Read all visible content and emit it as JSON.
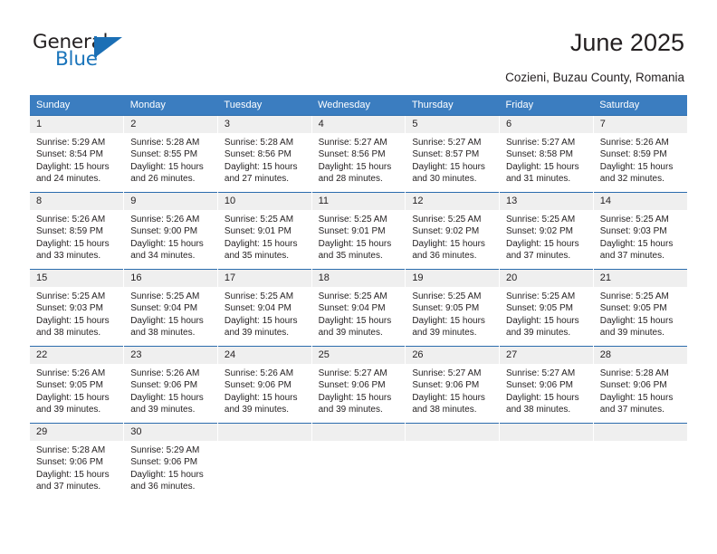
{
  "brand": {
    "name_part1": "General",
    "name_part2": "Blue",
    "accent_color": "#1b6fb5"
  },
  "header": {
    "title": "June 2025",
    "subtitle": "Cozieni, Buzau County, Romania"
  },
  "calendar": {
    "header_bg": "#3b7dc0",
    "daynum_bg": "#efefef",
    "row_divider_color": "#2b6cad",
    "weekday_headers": [
      "Sunday",
      "Monday",
      "Tuesday",
      "Wednesday",
      "Thursday",
      "Friday",
      "Saturday"
    ],
    "weeks": [
      [
        {
          "day": "1",
          "sunrise": "Sunrise: 5:29 AM",
          "sunset": "Sunset: 8:54 PM",
          "daylight1": "Daylight: 15 hours",
          "daylight2": "and 24 minutes."
        },
        {
          "day": "2",
          "sunrise": "Sunrise: 5:28 AM",
          "sunset": "Sunset: 8:55 PM",
          "daylight1": "Daylight: 15 hours",
          "daylight2": "and 26 minutes."
        },
        {
          "day": "3",
          "sunrise": "Sunrise: 5:28 AM",
          "sunset": "Sunset: 8:56 PM",
          "daylight1": "Daylight: 15 hours",
          "daylight2": "and 27 minutes."
        },
        {
          "day": "4",
          "sunrise": "Sunrise: 5:27 AM",
          "sunset": "Sunset: 8:56 PM",
          "daylight1": "Daylight: 15 hours",
          "daylight2": "and 28 minutes."
        },
        {
          "day": "5",
          "sunrise": "Sunrise: 5:27 AM",
          "sunset": "Sunset: 8:57 PM",
          "daylight1": "Daylight: 15 hours",
          "daylight2": "and 30 minutes."
        },
        {
          "day": "6",
          "sunrise": "Sunrise: 5:27 AM",
          "sunset": "Sunset: 8:58 PM",
          "daylight1": "Daylight: 15 hours",
          "daylight2": "and 31 minutes."
        },
        {
          "day": "7",
          "sunrise": "Sunrise: 5:26 AM",
          "sunset": "Sunset: 8:59 PM",
          "daylight1": "Daylight: 15 hours",
          "daylight2": "and 32 minutes."
        }
      ],
      [
        {
          "day": "8",
          "sunrise": "Sunrise: 5:26 AM",
          "sunset": "Sunset: 8:59 PM",
          "daylight1": "Daylight: 15 hours",
          "daylight2": "and 33 minutes."
        },
        {
          "day": "9",
          "sunrise": "Sunrise: 5:26 AM",
          "sunset": "Sunset: 9:00 PM",
          "daylight1": "Daylight: 15 hours",
          "daylight2": "and 34 minutes."
        },
        {
          "day": "10",
          "sunrise": "Sunrise: 5:25 AM",
          "sunset": "Sunset: 9:01 PM",
          "daylight1": "Daylight: 15 hours",
          "daylight2": "and 35 minutes."
        },
        {
          "day": "11",
          "sunrise": "Sunrise: 5:25 AM",
          "sunset": "Sunset: 9:01 PM",
          "daylight1": "Daylight: 15 hours",
          "daylight2": "and 35 minutes."
        },
        {
          "day": "12",
          "sunrise": "Sunrise: 5:25 AM",
          "sunset": "Sunset: 9:02 PM",
          "daylight1": "Daylight: 15 hours",
          "daylight2": "and 36 minutes."
        },
        {
          "day": "13",
          "sunrise": "Sunrise: 5:25 AM",
          "sunset": "Sunset: 9:02 PM",
          "daylight1": "Daylight: 15 hours",
          "daylight2": "and 37 minutes."
        },
        {
          "day": "14",
          "sunrise": "Sunrise: 5:25 AM",
          "sunset": "Sunset: 9:03 PM",
          "daylight1": "Daylight: 15 hours",
          "daylight2": "and 37 minutes."
        }
      ],
      [
        {
          "day": "15",
          "sunrise": "Sunrise: 5:25 AM",
          "sunset": "Sunset: 9:03 PM",
          "daylight1": "Daylight: 15 hours",
          "daylight2": "and 38 minutes."
        },
        {
          "day": "16",
          "sunrise": "Sunrise: 5:25 AM",
          "sunset": "Sunset: 9:04 PM",
          "daylight1": "Daylight: 15 hours",
          "daylight2": "and 38 minutes."
        },
        {
          "day": "17",
          "sunrise": "Sunrise: 5:25 AM",
          "sunset": "Sunset: 9:04 PM",
          "daylight1": "Daylight: 15 hours",
          "daylight2": "and 39 minutes."
        },
        {
          "day": "18",
          "sunrise": "Sunrise: 5:25 AM",
          "sunset": "Sunset: 9:04 PM",
          "daylight1": "Daylight: 15 hours",
          "daylight2": "and 39 minutes."
        },
        {
          "day": "19",
          "sunrise": "Sunrise: 5:25 AM",
          "sunset": "Sunset: 9:05 PM",
          "daylight1": "Daylight: 15 hours",
          "daylight2": "and 39 minutes."
        },
        {
          "day": "20",
          "sunrise": "Sunrise: 5:25 AM",
          "sunset": "Sunset: 9:05 PM",
          "daylight1": "Daylight: 15 hours",
          "daylight2": "and 39 minutes."
        },
        {
          "day": "21",
          "sunrise": "Sunrise: 5:25 AM",
          "sunset": "Sunset: 9:05 PM",
          "daylight1": "Daylight: 15 hours",
          "daylight2": "and 39 minutes."
        }
      ],
      [
        {
          "day": "22",
          "sunrise": "Sunrise: 5:26 AM",
          "sunset": "Sunset: 9:05 PM",
          "daylight1": "Daylight: 15 hours",
          "daylight2": "and 39 minutes."
        },
        {
          "day": "23",
          "sunrise": "Sunrise: 5:26 AM",
          "sunset": "Sunset: 9:06 PM",
          "daylight1": "Daylight: 15 hours",
          "daylight2": "and 39 minutes."
        },
        {
          "day": "24",
          "sunrise": "Sunrise: 5:26 AM",
          "sunset": "Sunset: 9:06 PM",
          "daylight1": "Daylight: 15 hours",
          "daylight2": "and 39 minutes."
        },
        {
          "day": "25",
          "sunrise": "Sunrise: 5:27 AM",
          "sunset": "Sunset: 9:06 PM",
          "daylight1": "Daylight: 15 hours",
          "daylight2": "and 39 minutes."
        },
        {
          "day": "26",
          "sunrise": "Sunrise: 5:27 AM",
          "sunset": "Sunset: 9:06 PM",
          "daylight1": "Daylight: 15 hours",
          "daylight2": "and 38 minutes."
        },
        {
          "day": "27",
          "sunrise": "Sunrise: 5:27 AM",
          "sunset": "Sunset: 9:06 PM",
          "daylight1": "Daylight: 15 hours",
          "daylight2": "and 38 minutes."
        },
        {
          "day": "28",
          "sunrise": "Sunrise: 5:28 AM",
          "sunset": "Sunset: 9:06 PM",
          "daylight1": "Daylight: 15 hours",
          "daylight2": "and 37 minutes."
        }
      ],
      [
        {
          "day": "29",
          "sunrise": "Sunrise: 5:28 AM",
          "sunset": "Sunset: 9:06 PM",
          "daylight1": "Daylight: 15 hours",
          "daylight2": "and 37 minutes."
        },
        {
          "day": "30",
          "sunrise": "Sunrise: 5:29 AM",
          "sunset": "Sunset: 9:06 PM",
          "daylight1": "Daylight: 15 hours",
          "daylight2": "and 36 minutes."
        },
        {
          "day": "",
          "sunrise": "",
          "sunset": "",
          "daylight1": "",
          "daylight2": ""
        },
        {
          "day": "",
          "sunrise": "",
          "sunset": "",
          "daylight1": "",
          "daylight2": ""
        },
        {
          "day": "",
          "sunrise": "",
          "sunset": "",
          "daylight1": "",
          "daylight2": ""
        },
        {
          "day": "",
          "sunrise": "",
          "sunset": "",
          "daylight1": "",
          "daylight2": ""
        },
        {
          "day": "",
          "sunrise": "",
          "sunset": "",
          "daylight1": "",
          "daylight2": ""
        }
      ]
    ]
  }
}
